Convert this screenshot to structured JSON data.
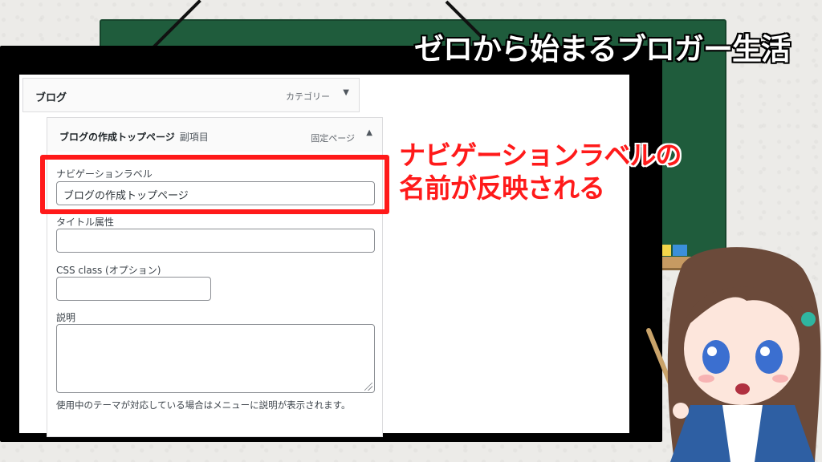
{
  "banner": {
    "title": "ゼロから始まるブロガー生活"
  },
  "menu": {
    "top_item": {
      "title": "ブログ",
      "type": "カテゴリー",
      "arrow": "▼"
    },
    "sub_item": {
      "title": "ブログの作成トップページ",
      "tag": "副項目",
      "type": "固定ページ",
      "arrow": "▲"
    }
  },
  "settings": {
    "nav_label": {
      "label": "ナビゲーションラベル",
      "value": "ブログの作成トップページ"
    },
    "title_attr": {
      "label": "タイトル属性",
      "value": ""
    },
    "css_class": {
      "label": "CSS class (オプション)",
      "value": ""
    },
    "description": {
      "label": "説明",
      "value": "",
      "help": "使用中のテーマが対応している場合はメニューに説明が表示されます。"
    }
  },
  "callout": {
    "line1": "ナビゲーションラベルの",
    "line2": "名前が反映される"
  },
  "colors": {
    "highlight": "#ff1a1a",
    "chalkboard": "#1f5c3c",
    "frame": "#000000"
  }
}
